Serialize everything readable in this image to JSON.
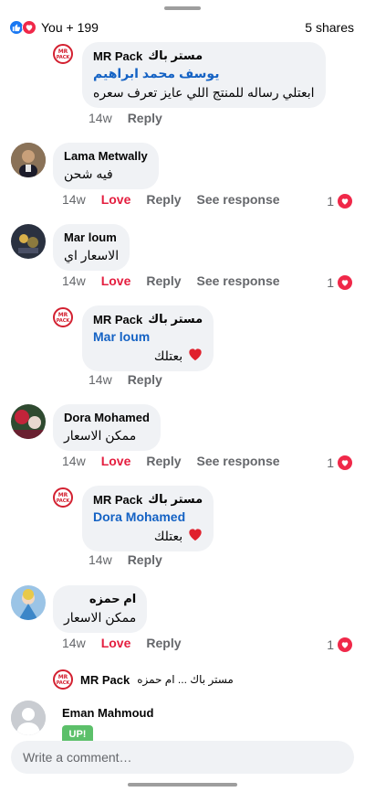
{
  "header": {
    "reactions_label": "You + 199",
    "shares_label": "5 shares"
  },
  "comments": [
    {
      "author_ar": "مستر باك",
      "author_en": "MR Pack",
      "mention": "يوسف محمد ابراهيم",
      "text": "ابعتلي رساله للمنتج اللي عايز تعرف سعره",
      "time": "14w",
      "reply": "Reply"
    },
    {
      "author": "Lama Metwally",
      "text": "فيه شحن",
      "time": "14w",
      "love": "Love",
      "reply": "Reply",
      "see_response": "See response",
      "reaction_count": "1"
    },
    {
      "author": "Mar loum",
      "text": "الاسعار اي",
      "time": "14w",
      "love": "Love",
      "reply": "Reply",
      "see_response": "See response",
      "reaction_count": "1"
    },
    {
      "author_ar": "مستر باك",
      "author_en": "MR Pack",
      "mention": "Mar loum",
      "text": "بعتلك",
      "time": "14w",
      "reply": "Reply"
    },
    {
      "author": "Dora Mohamed",
      "text": "ممكن الاسعار",
      "time": "14w",
      "love": "Love",
      "reply": "Reply",
      "see_response": "See response",
      "reaction_count": "1"
    },
    {
      "author_ar": "مستر باك",
      "author_en": "MR Pack",
      "mention": "Dora Mohamed",
      "text": "بعتلك",
      "time": "14w",
      "reply": "Reply"
    },
    {
      "author": "ام حمزه",
      "text": "ممكن الاسعار",
      "time": "14w",
      "love": "Love",
      "reply": "Reply",
      "reaction_count": "1"
    },
    {
      "author_en": "MR Pack",
      "preview": "مستر باك ... ام حمزه"
    },
    {
      "author": "Eman Mahmoud",
      "sticker_text": "UP!"
    }
  ],
  "composer": {
    "placeholder": "Write a comment…"
  },
  "colors": {
    "accent_blue": "#1877f2",
    "love_red": "#e41e3f",
    "bubble_bg": "#f0f2f5",
    "secondary_text": "#65676b"
  },
  "icons": {
    "like": "like-icon",
    "love": "love-icon",
    "heart": "heart-icon",
    "logo": "mr-pack-logo"
  }
}
